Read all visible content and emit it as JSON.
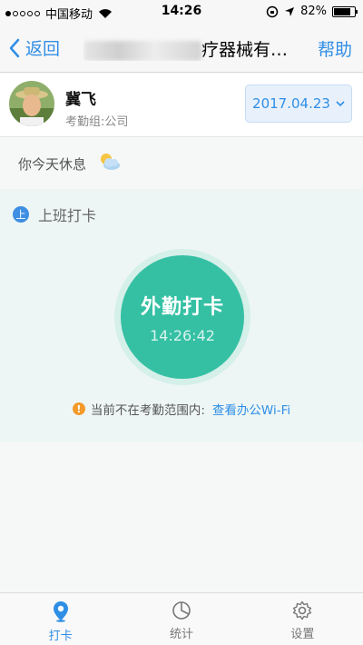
{
  "status_bar": {
    "carrier": "中国移动",
    "time": "14:26",
    "battery": "82%"
  },
  "nav": {
    "back_label": "返回",
    "title": "疗器械有…",
    "help_label": "帮助"
  },
  "profile": {
    "name": "冀飞",
    "group": "考勤组:公司",
    "date": "2017.04.23"
  },
  "rest": {
    "text": "你今天休息"
  },
  "clock_section": {
    "badge": "上",
    "label": "上班打卡",
    "button_label": "外勤打卡",
    "button_time": "14:26:42",
    "warning_text": "当前不在考勤范围内:",
    "link_text": "查看办公Wi-Fi"
  },
  "tabs": [
    {
      "label": "打卡",
      "icon": "location-pin-icon",
      "active": true
    },
    {
      "label": "统计",
      "icon": "pie-chart-icon",
      "active": false
    },
    {
      "label": "设置",
      "icon": "gear-icon",
      "active": false
    }
  ],
  "colors": {
    "accent": "#2f8ee6",
    "clock_button": "#35c0a4",
    "warning": "#f39a2b"
  }
}
